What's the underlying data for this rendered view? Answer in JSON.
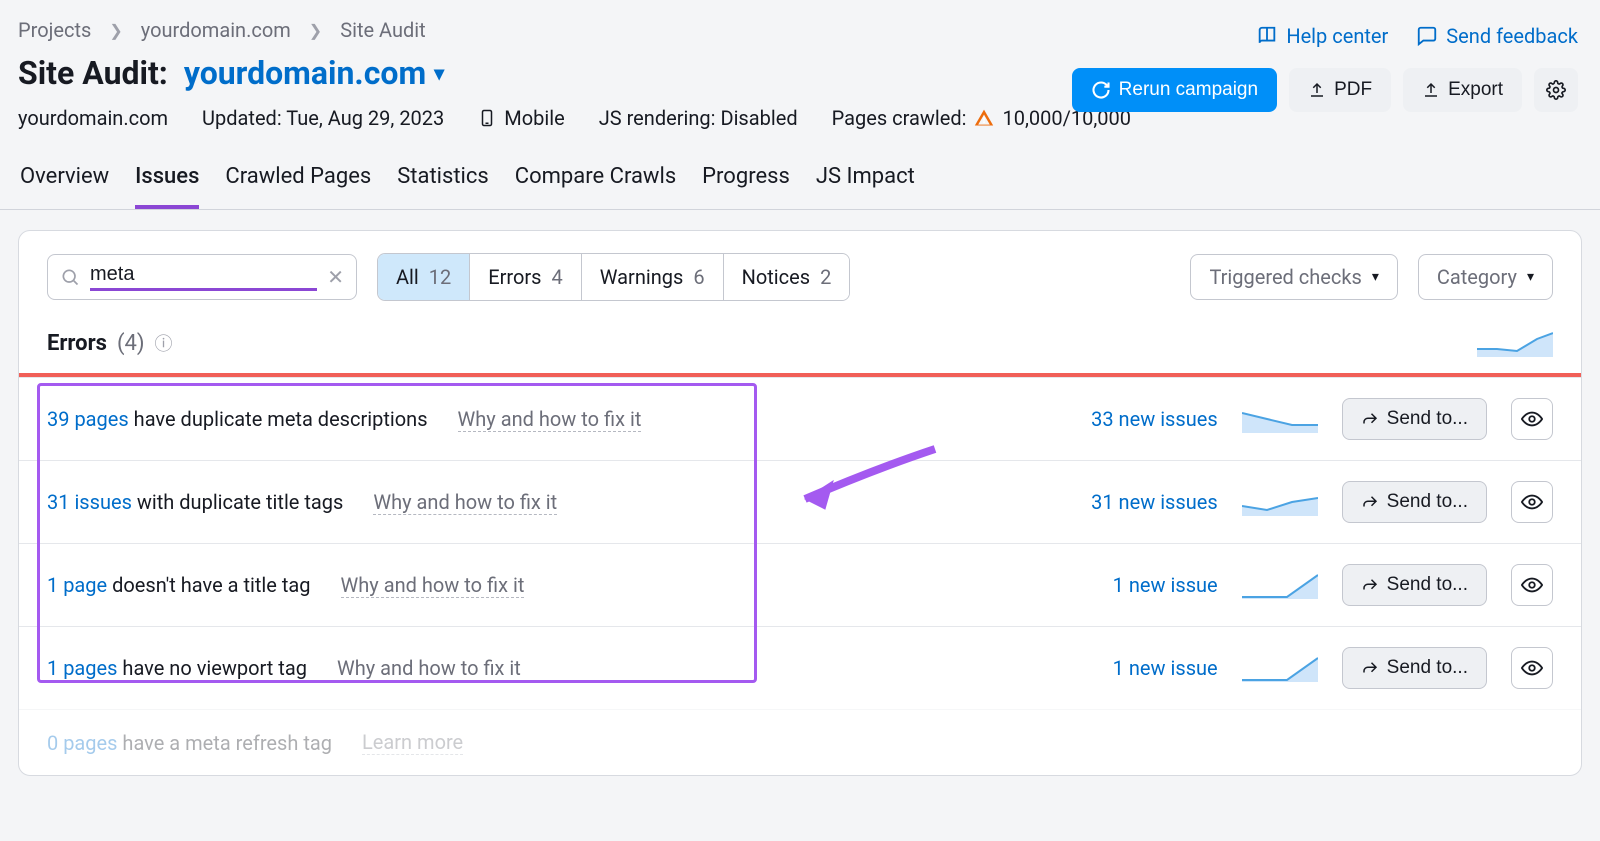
{
  "breadcrumbs": [
    "Projects",
    "yourdomain.com",
    "Site Audit"
  ],
  "topLinks": {
    "help": "Help center",
    "feedback": "Send feedback"
  },
  "title": {
    "label": "Site Audit:",
    "domain": "yourdomain.com"
  },
  "actions": {
    "rerun": "Rerun campaign",
    "pdf": "PDF",
    "export": "Export"
  },
  "meta": {
    "domain": "yourdomain.com",
    "updated": "Updated: Tue, Aug 29, 2023",
    "device": "Mobile",
    "js": "JS rendering: Disabled",
    "crawledLabel": "Pages crawled:",
    "crawledValue": "10,000/10,000"
  },
  "tabs": [
    "Overview",
    "Issues",
    "Crawled Pages",
    "Statistics",
    "Compare Crawls",
    "Progress",
    "JS Impact"
  ],
  "activeTab": "Issues",
  "search": {
    "value": "meta"
  },
  "segments": [
    {
      "label": "All",
      "count": "12",
      "active": true
    },
    {
      "label": "Errors",
      "count": "4"
    },
    {
      "label": "Warnings",
      "count": "6"
    },
    {
      "label": "Notices",
      "count": "2"
    }
  ],
  "dropdowns": {
    "triggered": "Triggered checks",
    "category": "Category"
  },
  "sectionHead": {
    "label": "Errors",
    "count": "(4)"
  },
  "whyLabel": "Why and how to fix it",
  "sendLabel": "Send to...",
  "issues": [
    {
      "pre": "39 pages",
      "post": " have duplicate meta descriptions",
      "new": "33 new issues"
    },
    {
      "pre": "31 issues",
      "post": " with duplicate title tags",
      "new": "31 new issues"
    },
    {
      "pre": "1 page",
      "post": " doesn't have a title tag",
      "new": "1 new issue"
    },
    {
      "pre": "1 pages",
      "post": " have no viewport tag",
      "new": "1 new issue"
    }
  ],
  "faded": {
    "pre": "0 pages",
    "post": " have a meta refresh tag",
    "learn": "Learn more"
  }
}
